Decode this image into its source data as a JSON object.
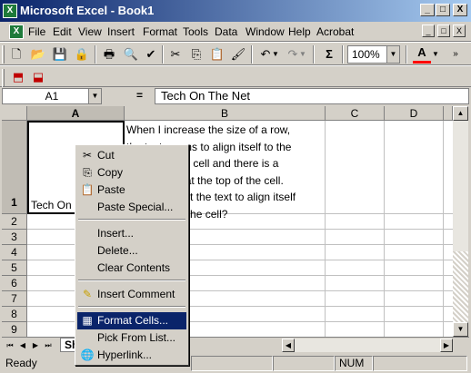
{
  "window": {
    "title": "Microsoft Excel - Book1",
    "controls": [
      "_",
      "□",
      "X"
    ],
    "doc_controls": [
      "_",
      "□",
      "X"
    ]
  },
  "menu": [
    "File",
    "Edit",
    "View",
    "Insert",
    "Format",
    "Tools",
    "Data",
    "Window",
    "Help",
    "Acrobat"
  ],
  "toolbar": {
    "zoom": "100%",
    "sigma": "Σ"
  },
  "formula": {
    "namebox": "A1",
    "fx": "=",
    "value": "Tech On The Net"
  },
  "columns": [
    "A",
    "B",
    "C",
    "D"
  ],
  "rows": [
    "1",
    "2",
    "3",
    "4",
    "5",
    "6",
    "7",
    "8",
    "9"
  ],
  "cells": {
    "A1": "Tech On The Net",
    "B1_lines": [
      "When I increase the size of a row,",
      "the text seems to align itself to the",
      "bottom of the cell and there is a",
      "lot of space at the top of the cell.",
      "How can I get the text to align itself",
      "to the top of the cell?"
    ]
  },
  "context_menu": [
    "Cut",
    "Copy",
    "Paste",
    "Paste Special...",
    "Insert...",
    "Delete...",
    "Clear Contents",
    "Insert Comment",
    "Format Cells...",
    "Pick From List...",
    "Hyperlink..."
  ],
  "sheet_tab": "Sheet1",
  "status": {
    "ready": "Ready",
    "num": "NUM"
  },
  "colors": {
    "title_start": "#0a246a",
    "title_end": "#a6caf0",
    "highlight": "#0a246a",
    "face": "#d4d0c8"
  }
}
